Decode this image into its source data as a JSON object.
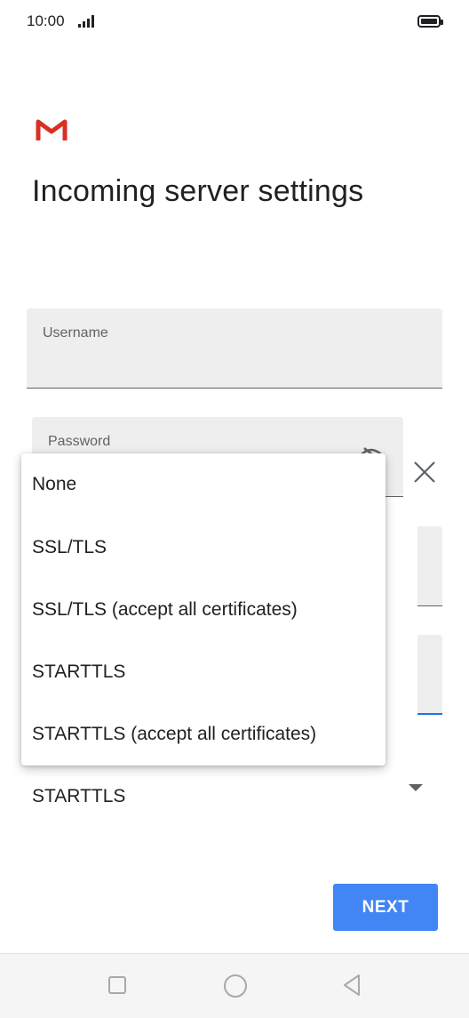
{
  "status_bar": {
    "time": "10:00",
    "icons": [
      "signal-icon",
      "battery-icon"
    ]
  },
  "app": {
    "logo": "gmail-logo",
    "title": "Incoming server settings"
  },
  "form": {
    "username": {
      "label": "Username",
      "value": ""
    },
    "password": {
      "label": "Password",
      "value": "",
      "icon": "visibility-off-icon"
    },
    "clear_icon": "close-icon",
    "security_type": {
      "value": "STARTTLS"
    }
  },
  "security_menu": {
    "items": [
      "None",
      "SSL/TLS",
      "SSL/TLS (accept all certificates)",
      "STARTTLS",
      "STARTTLS (accept all certificates)"
    ]
  },
  "actions": {
    "next_label": "NEXT"
  },
  "nav_bar": {
    "icons": [
      "recent-apps-icon",
      "home-icon",
      "back-icon"
    ]
  },
  "colors": {
    "accent": "#4285f4",
    "focus_underline": "#1a73e8",
    "field_bg": "#eeeeee",
    "gmail_red": "#d93025"
  }
}
